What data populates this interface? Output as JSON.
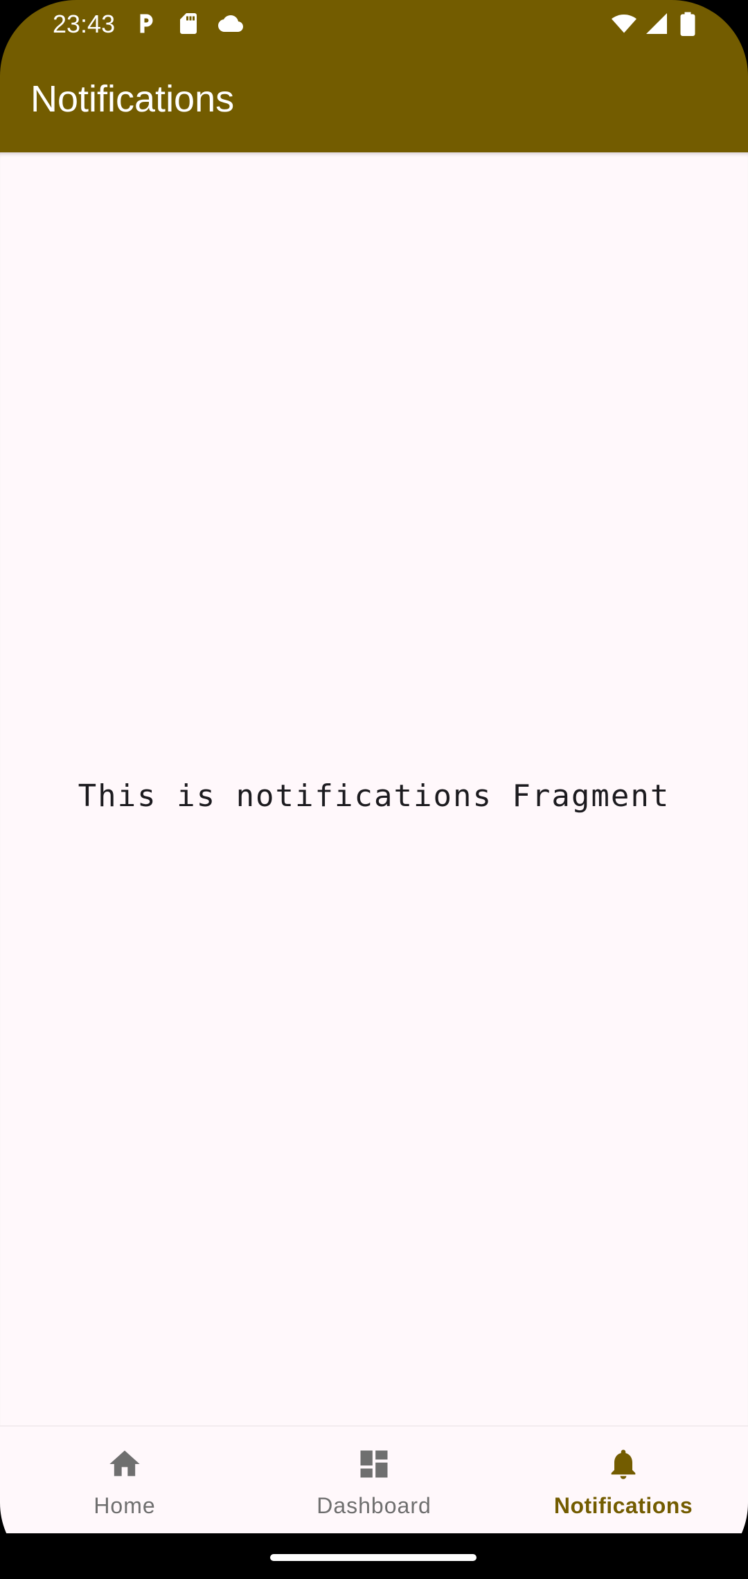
{
  "status_bar": {
    "time": "23:43",
    "left_icons": [
      "p-notification-icon",
      "sd-card-icon",
      "cloud-icon"
    ],
    "right_icons": [
      "wifi-icon",
      "cell-signal-icon",
      "battery-icon"
    ]
  },
  "app_bar": {
    "title": "Notifications",
    "color": "#735c00"
  },
  "content": {
    "text": "This is notifications Fragment",
    "background": "#fff8fb"
  },
  "bottom_nav": {
    "items": [
      {
        "label": "Home",
        "icon": "home-icon",
        "active": false
      },
      {
        "label": "Dashboard",
        "icon": "dashboard-icon",
        "active": false
      },
      {
        "label": "Notifications",
        "icon": "bell-icon",
        "active": true
      }
    ],
    "active_color": "#735c00",
    "inactive_color": "#6f6f6f"
  }
}
